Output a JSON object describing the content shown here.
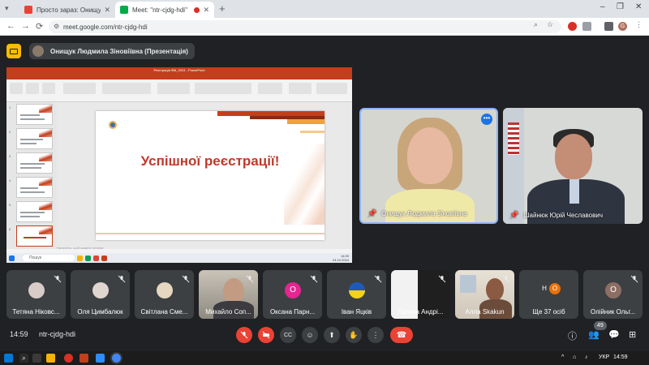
{
  "browser": {
    "tabs": [
      {
        "title": "Просто зараз: Онищук Людмил",
        "favicon_color": "#ea4335"
      },
      {
        "title": "Meet: \"ntr-cjdg-hdi\"",
        "favicon_color": "#00ac47",
        "active": true,
        "recording": true
      }
    ],
    "new_tab_glyph": "+",
    "window_controls": {
      "minimize": "–",
      "maximize": "❐",
      "close": "✕"
    },
    "url": "meet.google.com/ntr-cjdg-hdi",
    "nav": {
      "back": "←",
      "forward": "→",
      "reload": "⟳"
    },
    "profile_initial": "G"
  },
  "meet": {
    "presenter_name": "Онищук Людмила Зіновіївна (Презентація)",
    "time": "14:59",
    "meeting_code": "ntr-cjdg-hdi",
    "participants_badge": "49"
  },
  "shared_slide": {
    "app_title": "Реєстрація ФМ_2024 - PowerPoint",
    "title": "Успішної реєстрації!",
    "notes_placeholder": "Натисніть, щоб додати нотатки",
    "search_placeholder": "Пошук",
    "clock_time": "14:59",
    "clock_date": "24.10.2024",
    "accent_color": "#c43e1c"
  },
  "main_tiles": [
    {
      "name": "Онищук Людмила Зіновіївна",
      "pinned": true,
      "speaking": true
    },
    {
      "name": "Шайнюк Юрій Чеславович",
      "pinned": true
    }
  ],
  "participants": [
    {
      "name": "Тетяна Ніковс...",
      "type": "avatar",
      "avatar_color": "#d7ccc8"
    },
    {
      "name": "Оля Цимбалюк",
      "type": "avatar",
      "avatar_color": "#e0d6cf"
    },
    {
      "name": "Світлана Сме...",
      "type": "avatar",
      "avatar_color": "#e6d8c0"
    },
    {
      "name": "Михайло Соп...",
      "type": "video"
    },
    {
      "name": "Оксана Парн...",
      "type": "letter",
      "letter": "О",
      "letter_color": "#e52592"
    },
    {
      "name": "Іван Яцків",
      "type": "flag"
    },
    {
      "name": "Галина Андрі...",
      "type": "video-dark"
    },
    {
      "name": "Алла Skakun",
      "type": "video-room"
    },
    {
      "name": "Ще 37 осіб",
      "type": "more",
      "letters": [
        "Н",
        "О"
      ]
    },
    {
      "name": "Олійник Ольг...",
      "type": "letter",
      "letter": "О",
      "letter_color": "#8d6e63"
    }
  ],
  "controls": {
    "mic": "mic-off-icon",
    "camera": "camera-off-icon",
    "captions": "CC",
    "emoji": "☺",
    "present": "⬆",
    "hand": "✋",
    "more": "⋮",
    "hangup": "☎"
  },
  "os_taskbar": {
    "language": "УКР",
    "time": "14:59"
  }
}
